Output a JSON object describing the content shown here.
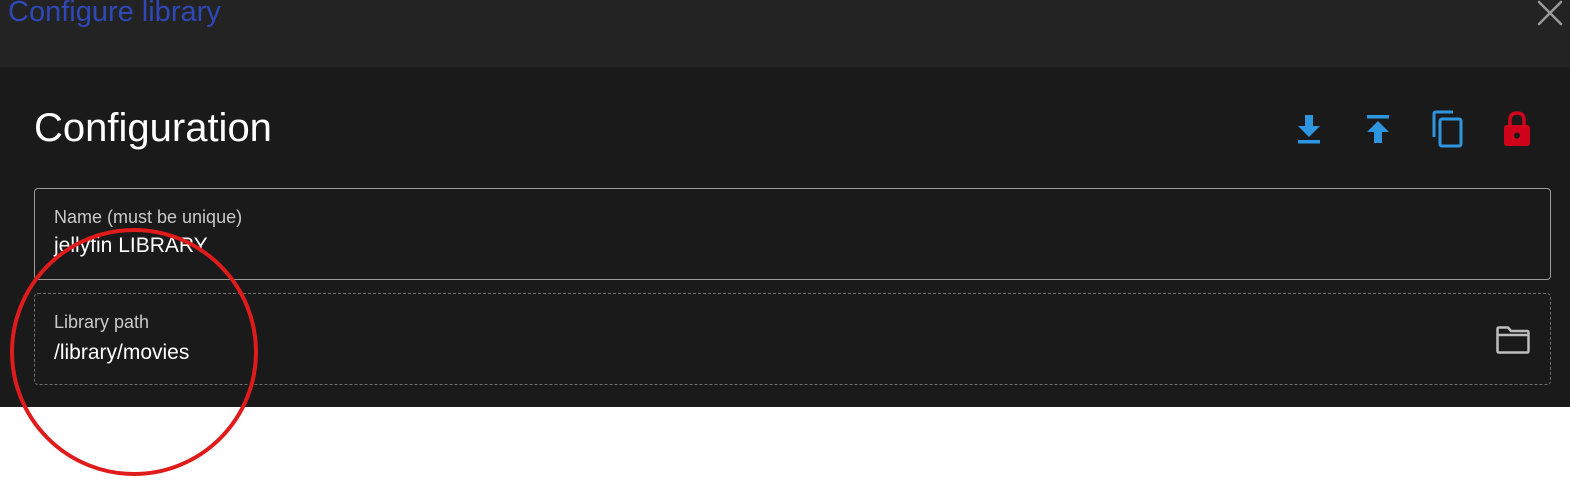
{
  "dialog": {
    "title": "Configure library",
    "close_icon": "close-icon"
  },
  "panel": {
    "title": "Configuration",
    "toolbar": [
      {
        "name": "download-button",
        "icon": "download-icon",
        "color": "#2e96e0"
      },
      {
        "name": "upload-button",
        "icon": "upload-icon",
        "color": "#2e96e0"
      },
      {
        "name": "copy-button",
        "icon": "copy-icon",
        "color": "#2e96e0"
      },
      {
        "name": "lock-button",
        "icon": "lock-icon",
        "color": "#d0021b"
      }
    ]
  },
  "fields": {
    "name": {
      "label": "Name (must be unique)",
      "value": "jellyfin LIBRARY"
    },
    "path": {
      "label": "Library path",
      "value": "/library/movies",
      "icon": "folder-icon"
    }
  },
  "colors": {
    "header_bg": "#232323",
    "panel_bg": "#1a1a1a",
    "title_blue": "#2e48b8",
    "icon_blue": "#2e96e0",
    "lock_red": "#d0021b",
    "annotation_red": "#e01b1b"
  }
}
